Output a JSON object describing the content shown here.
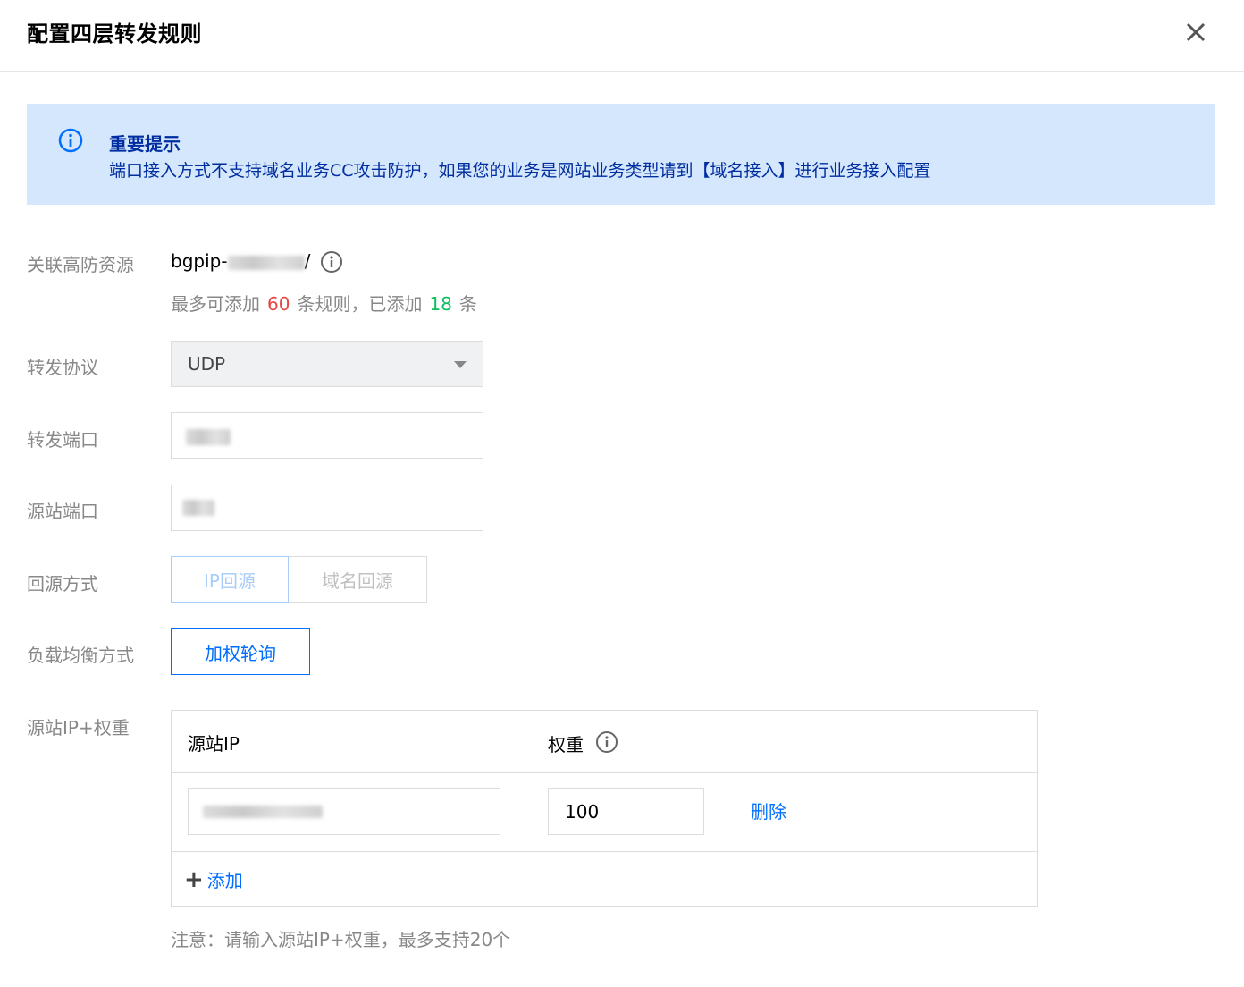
{
  "dialog": {
    "title": "配置四层转发规则",
    "close_label": "✕"
  },
  "notice": {
    "title": "重要提示",
    "text": "端口接入方式不支持域名业务CC攻击防护，如果您的业务是网站业务类型请到【域名接入】进行业务接入配置",
    "icon": "info-icon",
    "bg_color": "#d5e7fd"
  },
  "resource": {
    "label": "关联高防资源",
    "value_prefix": "bgpip-",
    "value_suffix": "/",
    "hint_before": "最多可添加",
    "max_rules": "60",
    "hint_middle": "条规则，已添加",
    "added_rules": "18",
    "hint_after": "条"
  },
  "protocol": {
    "label": "转发协议",
    "selected": "UDP"
  },
  "forward_port": {
    "label": "转发端口"
  },
  "origin_port": {
    "label": "源站端口"
  },
  "origin_method": {
    "label": "回源方式",
    "options": [
      "IP回源",
      "域名回源"
    ]
  },
  "load_balance": {
    "label": "负载均衡方式",
    "option": "加权轮询"
  },
  "origin_ip_weight": {
    "label": "源站IP+权重",
    "col_ip": "源站IP",
    "col_weight": "权重",
    "rows": [
      {
        "weight": "100",
        "delete_label": "删除"
      }
    ],
    "add_label": "添加"
  },
  "note": "注意：请输入源站IP+权重，最多支持20个",
  "colors": {
    "accent": "#006eff",
    "red": "#e54545",
    "green": "#0abf5b"
  }
}
